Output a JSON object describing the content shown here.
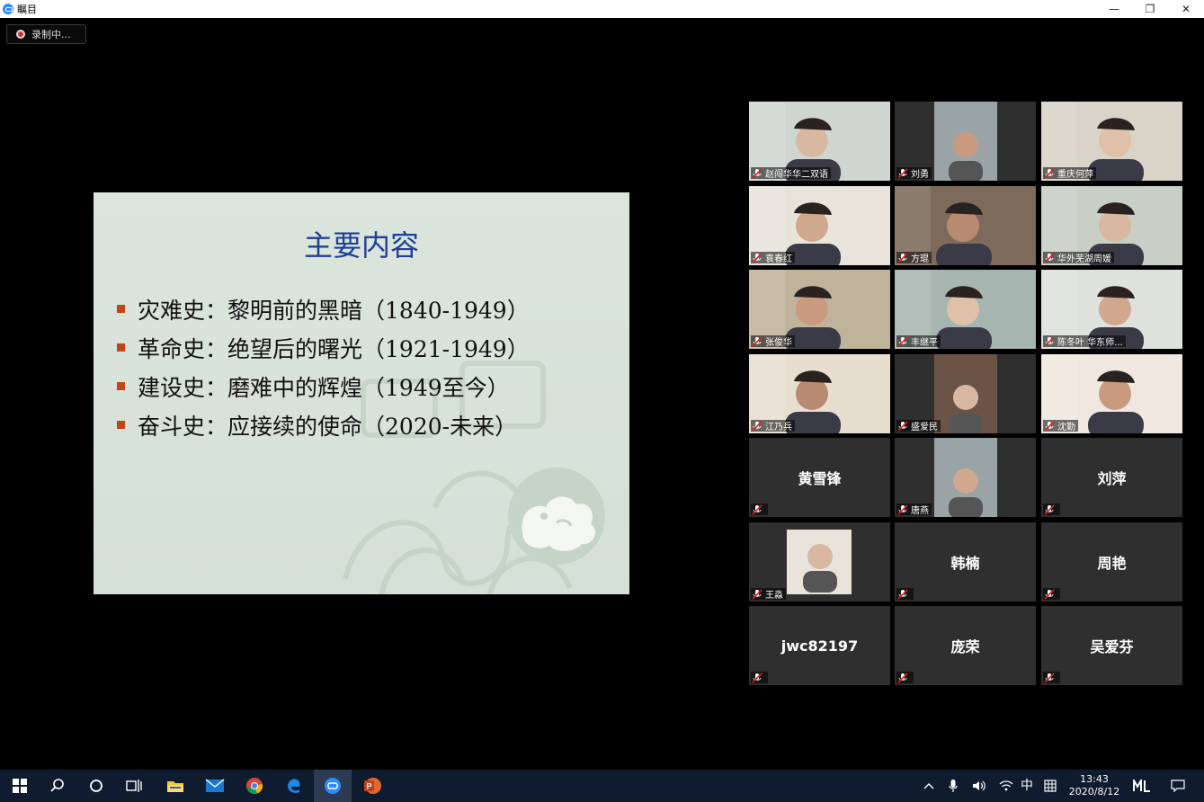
{
  "window": {
    "title": "瞩目",
    "controls": [
      "—",
      "❐",
      "✕"
    ]
  },
  "recording": {
    "label": "录制中..."
  },
  "slide": {
    "heading": "主要内容",
    "items": [
      "灾难史：黎明前的黑暗（1840-1949）",
      "革命史：绝望后的曙光（1921-1949）",
      "建设史：磨难中的辉煌（1949至今）",
      "奋斗史：应接续的使命（2020-未来）"
    ]
  },
  "participants": [
    {
      "name": "赵闯华华二双语",
      "video": true
    },
    {
      "name": "刘勇",
      "video": true
    },
    {
      "name": "重庆何萍",
      "video": true
    },
    {
      "name": "袁春红",
      "video": true
    },
    {
      "name": "方琨",
      "video": true
    },
    {
      "name": "华外芜湖周媛",
      "video": true
    },
    {
      "name": "张俊华",
      "video": true,
      "active_speaker": true
    },
    {
      "name": "丰继平",
      "video": true
    },
    {
      "name": "陈冬叶 华东师...",
      "video": true
    },
    {
      "name": "江乃兵",
      "video": true
    },
    {
      "name": "盛爱民",
      "video": true
    },
    {
      "name": "沈勤",
      "video": true
    },
    {
      "name": "黄雪锋",
      "video": false
    },
    {
      "name": "唐燕",
      "video": true
    },
    {
      "name": "刘萍",
      "video": false
    },
    {
      "name": "王淼",
      "video": true
    },
    {
      "name": "韩楠",
      "video": false
    },
    {
      "name": "周艳",
      "video": false
    },
    {
      "name": "jwc82197",
      "video": false
    },
    {
      "name": "庞荣",
      "video": false
    },
    {
      "name": "吴爱芬",
      "video": false
    }
  ],
  "taskbar": {
    "apps": [
      "windows-start",
      "search",
      "cortana",
      "task-view",
      "file-explorer",
      "mail",
      "chrome",
      "edge",
      "zhumu",
      "powerpoint"
    ],
    "tray": {
      "ime": "中",
      "time": "13:43",
      "date": "2020/8/12"
    }
  }
}
